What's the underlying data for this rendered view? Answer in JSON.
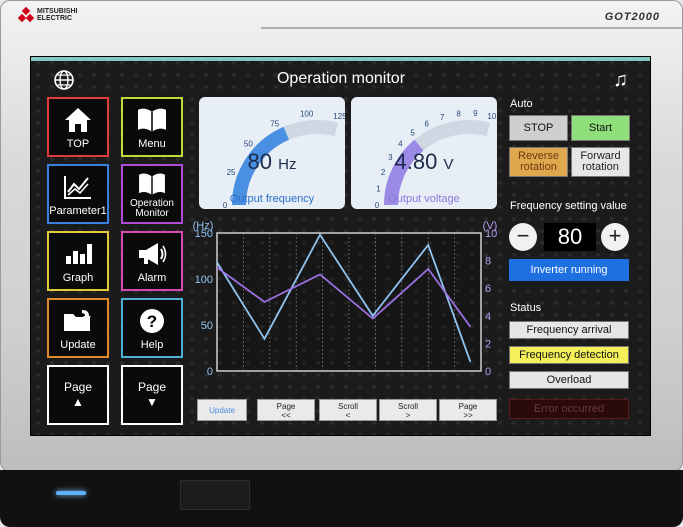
{
  "device": {
    "brand_line1": "MITSUBISHI",
    "brand_line2": "ELECTRIC",
    "model": "GOT2000"
  },
  "screen": {
    "title": "Operation monitor"
  },
  "nav": [
    {
      "label": "TOP",
      "icon": "home-icon",
      "border": "#e23b3b"
    },
    {
      "label": "Menu",
      "icon": "book-icon",
      "border": "#c4d83a"
    },
    {
      "label": "Parameter1",
      "icon": "graph-line-icon",
      "border": "#3c7de0"
    },
    {
      "label_line1": "Operation",
      "label_line2": "Monitor",
      "icon": "book-icon",
      "border": "#b04ad8"
    },
    {
      "label": "Graph",
      "icon": "bar-chart-icon",
      "border": "#e0c93a"
    },
    {
      "label": "Alarm",
      "icon": "megaphone-icon",
      "border": "#d84ab0"
    },
    {
      "label": "Update",
      "icon": "folder-icon",
      "border": "#e08a2a"
    },
    {
      "label": "Help",
      "icon": "help-icon",
      "border": "#4ab0d8"
    },
    {
      "label": "Page",
      "arrow": "▲",
      "icon": "page-up-icon",
      "border": "#ffffff"
    },
    {
      "label": "Page",
      "arrow": "▼",
      "icon": "page-down-icon",
      "border": "#ffffff"
    }
  ],
  "freq_gauge": {
    "value": "80",
    "unit": "Hz",
    "caption": "Output frequency",
    "ticks": [
      "0",
      "25",
      "50",
      "75",
      "100",
      "125"
    ],
    "max": 125,
    "level": 80,
    "color": "#4a90e2"
  },
  "volt_gauge": {
    "value": "4.80",
    "unit": "V",
    "caption": "Output voltage",
    "ticks": [
      "0",
      "1",
      "2",
      "3",
      "4",
      "5",
      "6",
      "7",
      "8",
      "9",
      "10"
    ],
    "max": 10,
    "level": 4.8,
    "color": "#9b8ae6"
  },
  "chart_data": {
    "type": "line",
    "y_left_label": "(Hz)",
    "y_right_label": "(V)",
    "y_left_ticks": [
      "150",
      "100",
      "50",
      "0"
    ],
    "y_right_ticks": [
      "10",
      "8",
      "6",
      "4",
      "2",
      "0"
    ],
    "ylim_left": [
      0,
      150
    ],
    "ylim_right": [
      0,
      10
    ],
    "grid": true,
    "series": [
      {
        "axis": "left",
        "color": "#8fc3f0",
        "x": [
          0,
          1,
          2,
          3,
          4,
          5,
          6
        ],
        "values": [
          118,
          35,
          148,
          60,
          137,
          10,
          10
        ]
      },
      {
        "axis": "right",
        "color": "#9b6fe0",
        "x": [
          0,
          1,
          2,
          3,
          4,
          5,
          6
        ],
        "values": [
          7.5,
          5,
          7,
          3.8,
          7.4,
          3.2,
          3.2
        ]
      }
    ]
  },
  "chart_buttons": [
    {
      "line1": "Update",
      "line2": "",
      "color": "#4a90e2"
    },
    {
      "line1": "Page",
      "line2": "<<",
      "color": "#222222"
    },
    {
      "line1": "Scroll",
      "line2": "<",
      "color": "#222222"
    },
    {
      "line1": "Scroll",
      "line2": ">",
      "color": "#222222"
    },
    {
      "line1": "Page",
      "line2": ">>",
      "color": "#222222"
    }
  ],
  "auto": {
    "label": "Auto",
    "stop": "STOP",
    "start": "Start",
    "reverse_line1": "Reverse",
    "reverse_line2": "rotation",
    "forward_line1": "Forward",
    "forward_line2": "rotation"
  },
  "freq_setting": {
    "label": "Frequency setting value",
    "minus": "−",
    "value": "80",
    "plus": "+",
    "running": "Inverter running"
  },
  "status": {
    "label": "Status",
    "items": [
      {
        "text": "Frequency arrival",
        "bg": "#e6e6e6",
        "fg": "#111111"
      },
      {
        "text": "Frequency detection",
        "bg": "#f3f05a",
        "fg": "#111111"
      },
      {
        "text": "Overload",
        "bg": "#e6e6e6",
        "fg": "#111111"
      },
      {
        "text": "Error occurred",
        "bg": "#2a0a0a",
        "fg": "#6a3a3a"
      }
    ]
  }
}
